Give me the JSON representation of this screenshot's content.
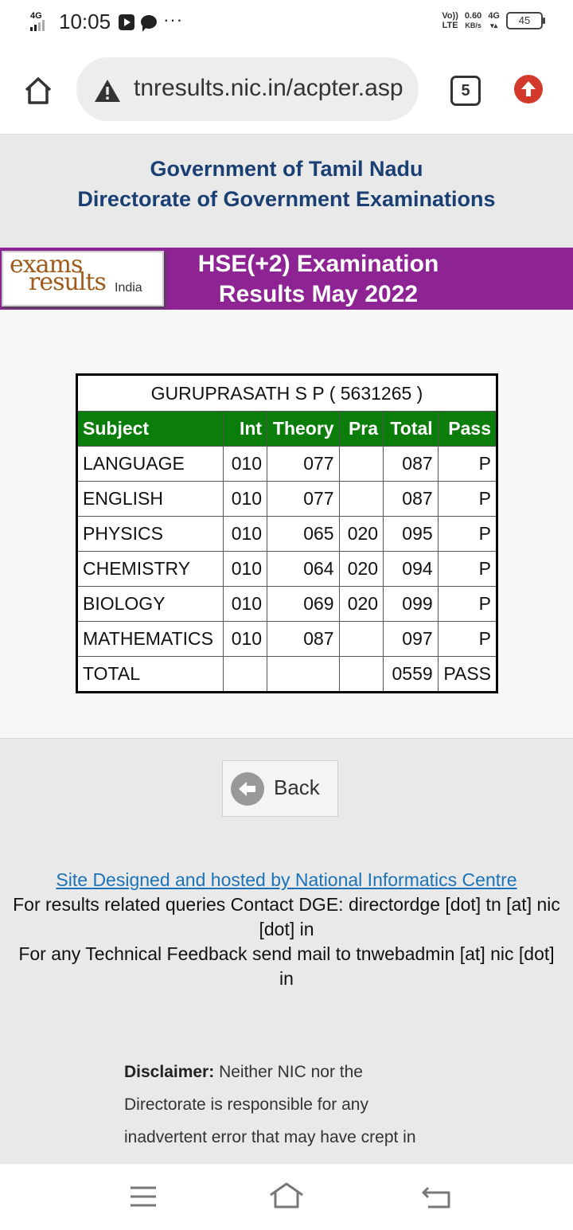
{
  "status_bar": {
    "network": "4G",
    "time": "10:05",
    "speed": "0.60",
    "speed_unit": "KB/s",
    "volte": "Vo))",
    "lte": "LTE",
    "net_right": "4G",
    "battery": "45"
  },
  "browser": {
    "url": "tnresults.nic.in/acpter.asp",
    "tab_count": "5"
  },
  "header": {
    "line1": "Government of Tamil Nadu",
    "line2": "Directorate of Government Examinations"
  },
  "banner": {
    "logo_part1": "exams",
    "logo_part2": "results",
    "logo_part3": "India",
    "title_line1": "HSE(+2)  Examination",
    "title_line2": "Results  May 2022"
  },
  "result": {
    "student": "GURUPRASATH S P    ( 5631265 )",
    "columns": [
      "Subject",
      "Int",
      "Theory",
      "Pra",
      "Total",
      "Pass"
    ],
    "rows": [
      [
        "LANGUAGE",
        "010",
        "077",
        "",
        "087",
        "P"
      ],
      [
        "ENGLISH",
        "010",
        "077",
        "",
        "087",
        "P"
      ],
      [
        "PHYSICS",
        "010",
        "065",
        "020",
        "095",
        "P"
      ],
      [
        "CHEMISTRY",
        "010",
        "064",
        "020",
        "094",
        "P"
      ],
      [
        "BIOLOGY",
        "010",
        "069",
        "020",
        "099",
        "P"
      ],
      [
        "MATHEMATICS",
        "010",
        "087",
        "",
        "097",
        "P"
      ],
      [
        "TOTAL",
        "",
        "",
        "",
        "0559",
        "PASS"
      ]
    ]
  },
  "back_label": "Back",
  "footer": {
    "link": "Site Designed and hosted by National Informatics Centre",
    "contact": "For results related queries Contact DGE:  directordge [dot] tn [at] nic [dot] in",
    "feedback": "For any Technical Feedback send mail to tnwebadmin [at] nic [dot] in"
  },
  "disclaimer": {
    "label": "Disclaimer:",
    "text": " Neither NIC nor the Directorate is responsible for any inadvertent error that may have crept in"
  }
}
